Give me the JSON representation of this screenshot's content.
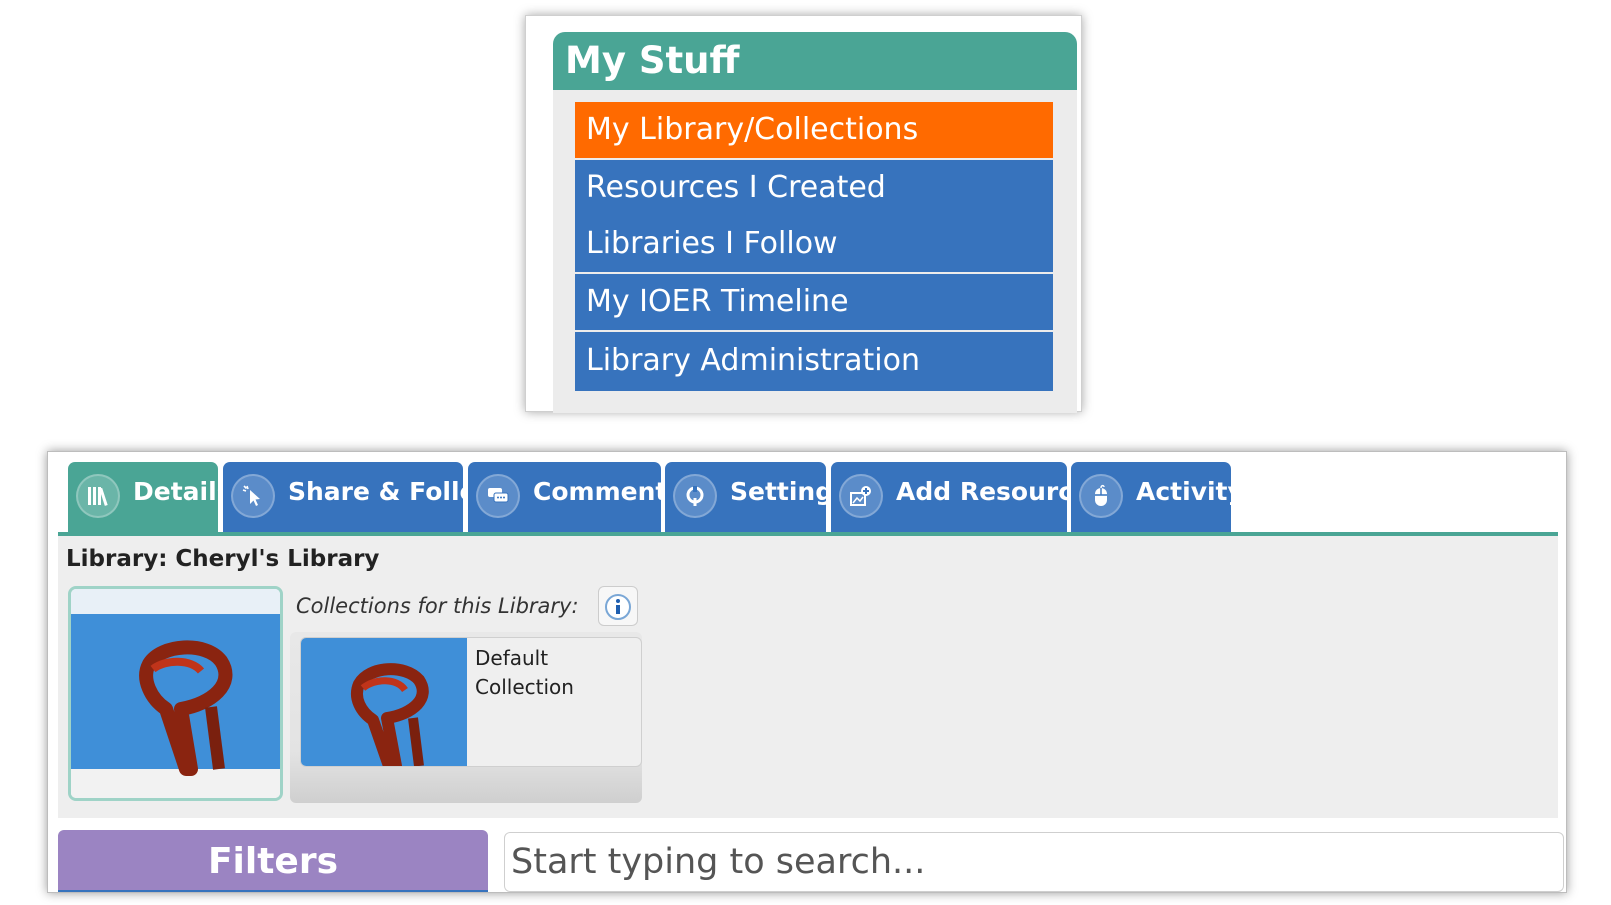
{
  "my_stuff": {
    "title": "My Stuff",
    "items": [
      {
        "label": "My Library/Collections",
        "active": true
      },
      {
        "label": "Resources I Created"
      },
      {
        "label": "Libraries I Follow"
      },
      {
        "label": "My IOER Timeline"
      },
      {
        "label": "Library Administration"
      }
    ]
  },
  "tabs": [
    {
      "label": "Details",
      "icon": "library-books-icon",
      "active": true
    },
    {
      "label": "Share & Follow",
      "icon": "cursor-click-icon"
    },
    {
      "label": "Comments",
      "icon": "comment-bubbles-icon"
    },
    {
      "label": "Settings",
      "icon": "settings-wrench-icon"
    },
    {
      "label": "Add Resources",
      "icon": "add-resources-icon"
    },
    {
      "label": "Activity",
      "icon": "mouse-icon"
    }
  ],
  "library": {
    "title": "Library: Cheryl's Library",
    "collections_label": "Collections for this Library:",
    "collections": [
      {
        "name": "Default Collection"
      }
    ]
  },
  "filters": {
    "label": "Filters"
  },
  "search": {
    "placeholder": "Start typing to search..."
  },
  "colors": {
    "teal": "#4aa595",
    "blue": "#3773bd",
    "orange": "#ff6a00",
    "purple": "#9b84c2"
  }
}
